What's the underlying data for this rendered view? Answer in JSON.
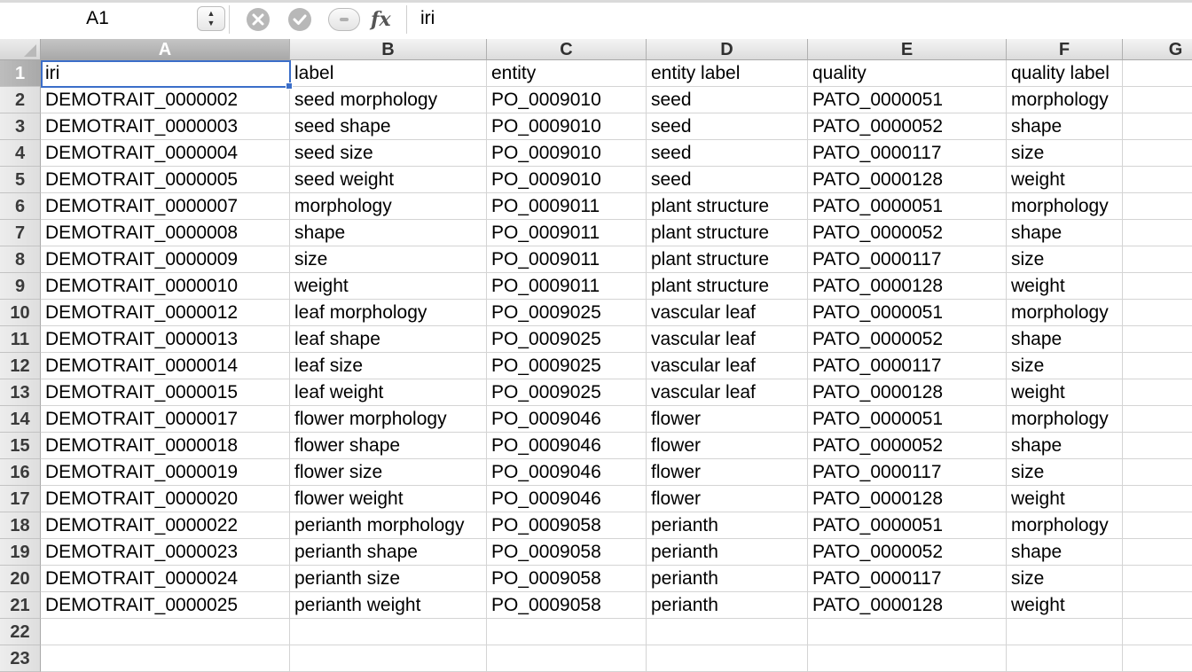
{
  "formula_bar": {
    "cell_reference": "A1",
    "formula_text": "iri",
    "fx_label": "fx",
    "stepper_up": "▲",
    "stepper_down": "▼",
    "cancel_icon": "x-circle-icon",
    "enter_icon": "check-circle-icon"
  },
  "sheet": {
    "active_cell": "A1",
    "accent_color": "#3b6ec9",
    "columns": [
      "A",
      "B",
      "C",
      "D",
      "E",
      "F",
      "G"
    ],
    "rows": [
      [
        "iri",
        "label",
        "entity",
        "entity label",
        "quality",
        "quality label"
      ],
      [
        "DEMOTRAIT_0000002",
        "seed morphology",
        "PO_0009010",
        "seed",
        "PATO_0000051",
        "morphology"
      ],
      [
        "DEMOTRAIT_0000003",
        "seed shape",
        "PO_0009010",
        "seed",
        "PATO_0000052",
        "shape"
      ],
      [
        "DEMOTRAIT_0000004",
        "seed size",
        "PO_0009010",
        "seed",
        "PATO_0000117",
        "size"
      ],
      [
        "DEMOTRAIT_0000005",
        "seed weight",
        "PO_0009010",
        "seed",
        "PATO_0000128",
        "weight"
      ],
      [
        "DEMOTRAIT_0000007",
        "morphology",
        "PO_0009011",
        "plant structure",
        "PATO_0000051",
        "morphology"
      ],
      [
        "DEMOTRAIT_0000008",
        "shape",
        "PO_0009011",
        "plant structure",
        "PATO_0000052",
        "shape"
      ],
      [
        "DEMOTRAIT_0000009",
        "size",
        "PO_0009011",
        "plant structure",
        "PATO_0000117",
        "size"
      ],
      [
        "DEMOTRAIT_0000010",
        "weight",
        "PO_0009011",
        "plant structure",
        "PATO_0000128",
        "weight"
      ],
      [
        "DEMOTRAIT_0000012",
        "leaf morphology",
        "PO_0009025",
        "vascular leaf",
        "PATO_0000051",
        "morphology"
      ],
      [
        "DEMOTRAIT_0000013",
        "leaf shape",
        "PO_0009025",
        "vascular leaf",
        "PATO_0000052",
        "shape"
      ],
      [
        "DEMOTRAIT_0000014",
        "leaf size",
        "PO_0009025",
        "vascular leaf",
        "PATO_0000117",
        "size"
      ],
      [
        "DEMOTRAIT_0000015",
        "leaf weight",
        "PO_0009025",
        "vascular leaf",
        "PATO_0000128",
        "weight"
      ],
      [
        "DEMOTRAIT_0000017",
        "flower morphology",
        "PO_0009046",
        "flower",
        "PATO_0000051",
        "morphology"
      ],
      [
        "DEMOTRAIT_0000018",
        "flower shape",
        "PO_0009046",
        "flower",
        "PATO_0000052",
        "shape"
      ],
      [
        "DEMOTRAIT_0000019",
        "flower size",
        "PO_0009046",
        "flower",
        "PATO_0000117",
        "size"
      ],
      [
        "DEMOTRAIT_0000020",
        "flower weight",
        "PO_0009046",
        "flower",
        "PATO_0000128",
        "weight"
      ],
      [
        "DEMOTRAIT_0000022",
        "perianth morphology",
        "PO_0009058",
        "perianth",
        "PATO_0000051",
        "morphology"
      ],
      [
        "DEMOTRAIT_0000023",
        "perianth shape",
        "PO_0009058",
        "perianth",
        "PATO_0000052",
        "shape"
      ],
      [
        "DEMOTRAIT_0000024",
        "perianth size",
        "PO_0009058",
        "perianth",
        "PATO_0000117",
        "size"
      ],
      [
        "DEMOTRAIT_0000025",
        "perianth weight",
        "PO_0009058",
        "perianth",
        "PATO_0000128",
        "weight"
      ],
      [
        "",
        "",
        "",
        "",
        "",
        ""
      ],
      [
        "",
        "",
        "",
        "",
        "",
        ""
      ]
    ],
    "row_numbers": [
      "1",
      "2",
      "3",
      "4",
      "5",
      "6",
      "7",
      "8",
      "9",
      "10",
      "11",
      "12",
      "13",
      "14",
      "15",
      "16",
      "17",
      "18",
      "19",
      "20",
      "21",
      "22",
      "23"
    ]
  }
}
